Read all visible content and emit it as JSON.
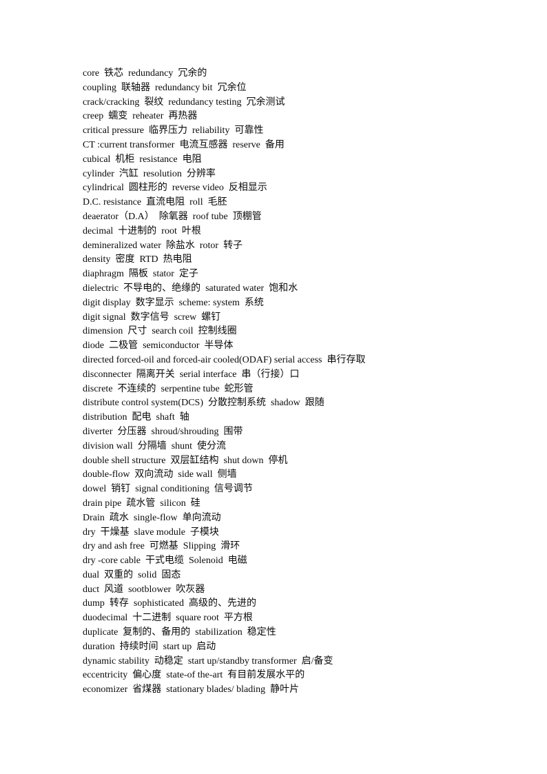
{
  "document": {
    "lines": [
      "core  铁芯  redundancy  冗余的",
      "coupling  联轴器  redundancy bit  冗余位",
      "crack/cracking  裂纹  redundancy testing  冗余测试",
      "creep  蠕变  reheater  再热器",
      "critical pressure  临界压力  reliability  可靠性",
      "CT :current transformer  电流互感器  reserve  备用",
      "cubical  机柜  resistance  电阻",
      "cylinder  汽缸  resolution  分辨率",
      "cylindrical  圆柱形的  reverse video  反相显示",
      "D.C. resistance  直流电阻  roll  毛胚",
      "deaerator（D.A）  除氧器  roof tube  顶棚管",
      "decimal  十进制的  root  叶根",
      "demineralized water  除盐水  rotor  转子",
      "density  密度  RTD  热电阻",
      "diaphragm  隔板  stator  定子",
      "dielectric  不导电的、绝缘的  saturated water  饱和水",
      "digit display  数字显示  scheme: system  系统",
      "digit signal  数字信号  screw  螺钉",
      "dimension  尺寸  search coil  控制线圈",
      "diode  二极管  semiconductor  半导体",
      "directed forced-oil and forced-air cooled(ODAF) serial access  串行存取",
      "disconnecter  隔离开关  serial interface  串（行接）口",
      "discrete  不连续的  serpentine tube  蛇形管",
      "distribute control system(DCS)  分散控制系统  shadow  跟随",
      "distribution  配电  shaft  轴",
      "diverter  分压器  shroud/shrouding  围带",
      "division wall  分隔墙  shunt  使分流",
      "double shell structure  双层缸结构  shut down  停机",
      "double-flow  双向流动  side wall  侧墙",
      "dowel  销钉  signal conditioning  信号调节",
      "drain pipe  疏水管  silicon  硅",
      "Drain  疏水  single-flow  单向流动",
      "dry  干燥基  slave module  子模块",
      "dry and ash free  可燃基  Slipping  滑环",
      "dry -core cable  干式电缆  Solenoid  电磁",
      "dual  双重的  solid  固态",
      "duct  风道  sootblower  吹灰器",
      "dump  转存  sophisticated  高级的、先进的",
      "duodecimal  十二进制  square root  平方根",
      "duplicate  复制的、备用的  stabilization  稳定性",
      "duration  持续时间  start up  启动",
      "dynamic stability  动稳定  start up/standby transformer  启/备变",
      "eccentricity  偏心度  state-of the-art  有目前发展水平的",
      "economizer  省煤器  stationary blades/ blading  静叶片"
    ]
  }
}
